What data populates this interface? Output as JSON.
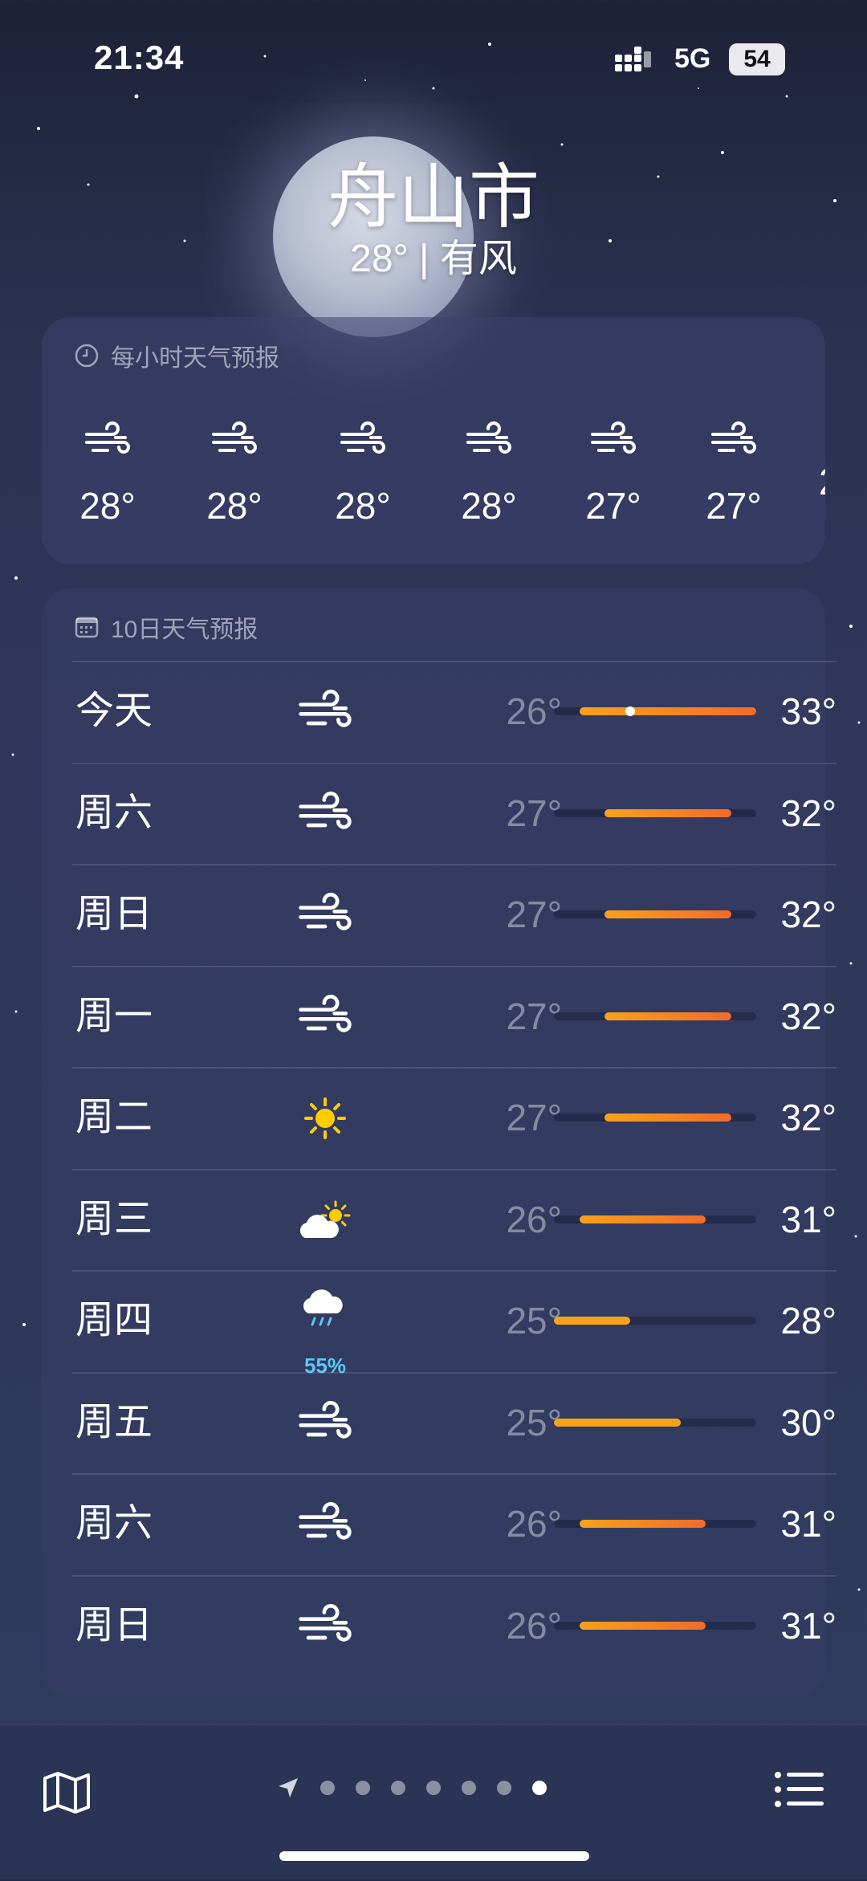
{
  "status": {
    "time": "21:34",
    "network": "5G",
    "battery": "54"
  },
  "location": {
    "city": "舟山市",
    "summary": "28° | 有风"
  },
  "hourly": {
    "title": "每小时天气预报",
    "items": [
      {
        "icon": "wind-icon",
        "temp": "28°"
      },
      {
        "icon": "wind-icon",
        "temp": "28°"
      },
      {
        "icon": "wind-icon",
        "temp": "28°"
      },
      {
        "icon": "wind-icon",
        "temp": "28°"
      },
      {
        "icon": "wind-icon",
        "temp": "27°"
      },
      {
        "icon": "wind-icon",
        "temp": "27°"
      }
    ]
  },
  "daily": {
    "title": "10日天气预报",
    "range_min": 25,
    "range_max": 33,
    "days": [
      {
        "day": "今天",
        "icon": "wind-icon",
        "low": "26°",
        "high": "33°",
        "lo": 26,
        "hi": 33,
        "current": 28
      },
      {
        "day": "周六",
        "icon": "wind-icon",
        "low": "27°",
        "high": "32°",
        "lo": 27,
        "hi": 32
      },
      {
        "day": "周日",
        "icon": "wind-icon",
        "low": "27°",
        "high": "32°",
        "lo": 27,
        "hi": 32
      },
      {
        "day": "周一",
        "icon": "wind-icon",
        "low": "27°",
        "high": "32°",
        "lo": 27,
        "hi": 32
      },
      {
        "day": "周二",
        "icon": "sun-icon",
        "low": "27°",
        "high": "32°",
        "lo": 27,
        "hi": 32
      },
      {
        "day": "周三",
        "icon": "partly-cloudy-icon",
        "low": "26°",
        "high": "31°",
        "lo": 26,
        "hi": 31
      },
      {
        "day": "周四",
        "icon": "rain-icon",
        "precip": "55%",
        "low": "25°",
        "high": "28°",
        "lo": 25,
        "hi": 28
      },
      {
        "day": "周五",
        "icon": "wind-icon",
        "low": "25°",
        "high": "30°",
        "lo": 25,
        "hi": 30
      },
      {
        "day": "周六",
        "icon": "wind-icon",
        "low": "26°",
        "high": "31°",
        "lo": 26,
        "hi": 31
      },
      {
        "day": "周日",
        "icon": "wind-icon",
        "low": "26°",
        "high": "31°",
        "lo": 26,
        "hi": 31
      }
    ]
  },
  "pager": {
    "pages": 8,
    "active_page": 7
  },
  "colors": {
    "bar_warm": "#f7a21b",
    "bar_hot": "#f26b2a",
    "precip": "#5ac8fa"
  }
}
